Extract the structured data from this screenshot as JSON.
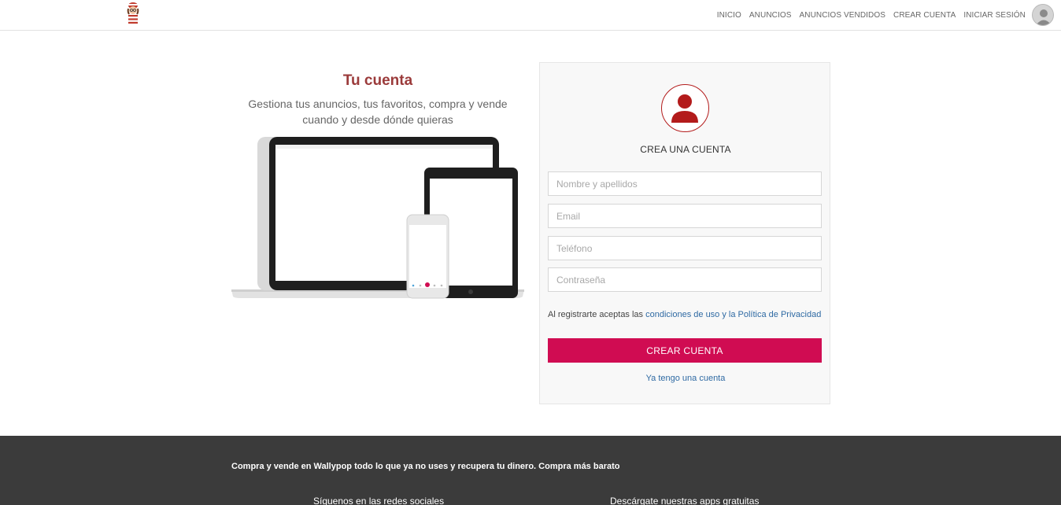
{
  "header": {
    "logo_icon": "wally-character-icon",
    "nav": [
      "INICIO",
      "ANUNCIOS",
      "ANUNCIOS VENDIDOS",
      "CREAR CUENTA",
      "INICIAR SESIÓN"
    ],
    "avatar_icon": "user-avatar-icon"
  },
  "promo": {
    "title": "Tu cuenta",
    "subtitle_line1": "Gestiona tus anuncios, tus favoritos, compra y vende",
    "subtitle_line2": "cuando y desde dónde quieras",
    "illustration": "devices-illustration"
  },
  "form": {
    "icon": "user-icon",
    "title": "CREA UNA CUENTA",
    "name_placeholder": "Nombre y apellidos",
    "email_placeholder": "Email",
    "phone_placeholder": "Teléfono",
    "password_placeholder": "Contraseña",
    "terms_prefix": "Al registrarte aceptas las",
    "terms_link": "condiciones de uso y la Política de Privacidad",
    "submit_label": "CREAR CUENTA",
    "login_link": "Ya tengo una cuenta"
  },
  "footer": {
    "tagline": "Compra y vende en Wallypop todo lo que ya no uses y recupera tu dinero. Compra más barato",
    "social_heading": "Síguenos en las redes sociales",
    "apps_heading": "Descárgate nuestras apps gratuitas"
  },
  "colors": {
    "accent": "#d00c52",
    "title": "#9b3b3b",
    "icon_red": "#b31b1b",
    "link": "#2f6aa3",
    "footer_bg": "#3b3b3b"
  }
}
